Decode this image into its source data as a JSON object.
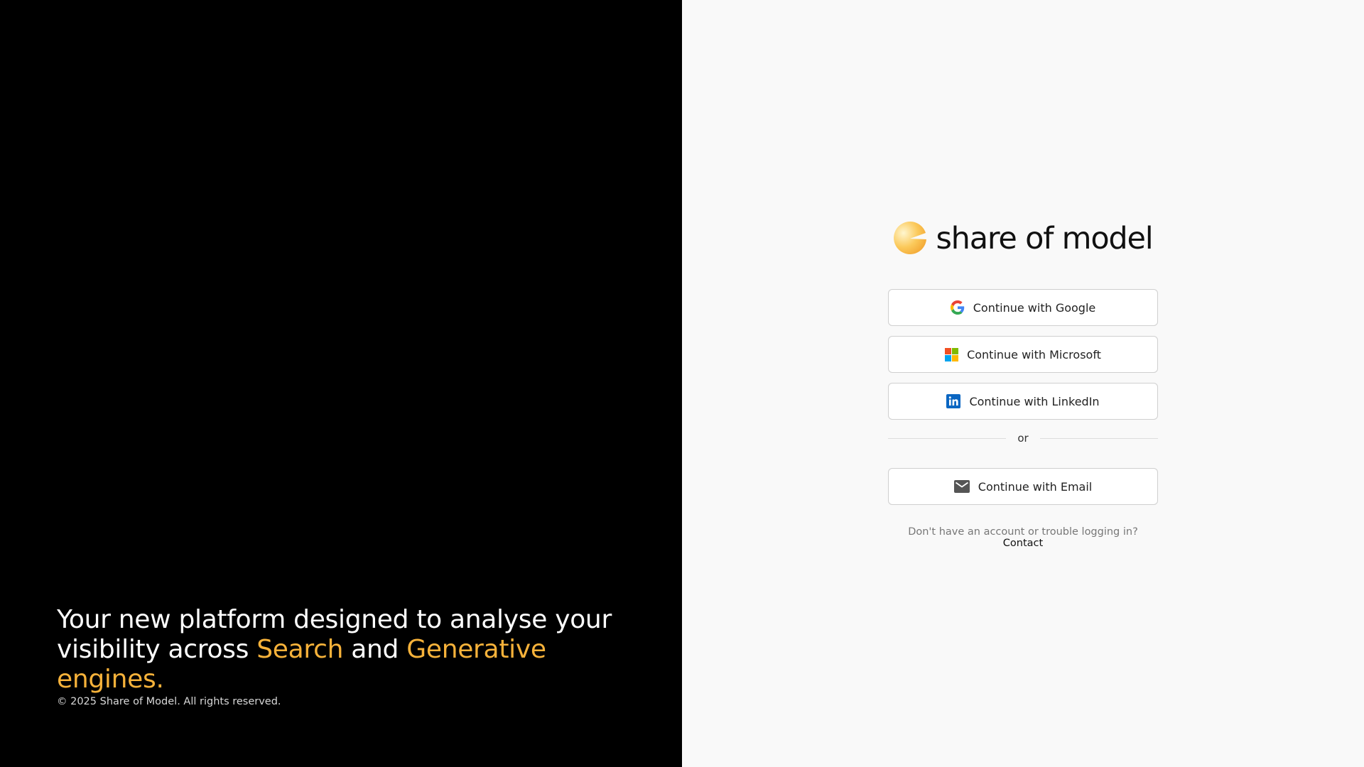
{
  "hero": {
    "tagline_part1": "Your new platform designed to analyse your visibility across ",
    "tagline_search": "Search",
    "tagline_and": " and ",
    "tagline_generative": "Generative engines.",
    "accent_color": "#f7b23a",
    "copyright": "© 2025 Share of Model. All rights reserved."
  },
  "brand": {
    "name": "share of model",
    "logo_icon": "pacman-gradient-logo"
  },
  "auth": {
    "google_label": "Continue with Google",
    "google_icon": "google-icon",
    "microsoft_label": "Continue with Microsoft",
    "microsoft_icon": "microsoft-icon",
    "linkedin_label": "Continue with LinkedIn",
    "linkedin_icon": "linkedin-icon",
    "divider_text": "or",
    "email_label": "Continue with Email",
    "email_icon": "mail-icon"
  },
  "help": {
    "text": "Don't have an account or trouble logging in?",
    "contact_label": "Contact"
  },
  "colors": {
    "left_bg": "#000000",
    "right_bg": "#f9f9f9",
    "accent": "#f7b23a",
    "linkedin_blue": "#0a66c2"
  }
}
